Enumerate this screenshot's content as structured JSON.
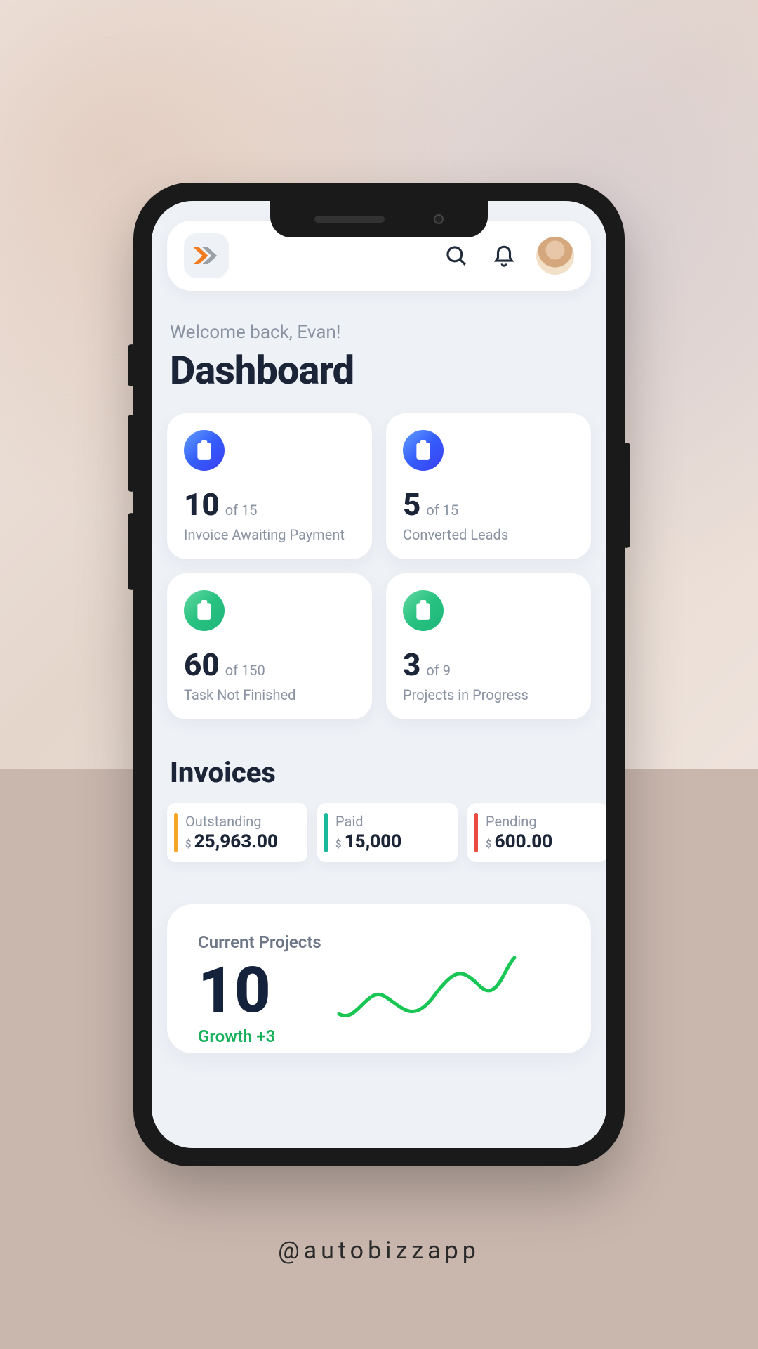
{
  "greeting": "Welcome back, Evan!",
  "page_title": "Dashboard",
  "stats": [
    {
      "value": "10",
      "of": "of 15",
      "label": "Invoice Awaiting Payment",
      "color": "blue"
    },
    {
      "value": "5",
      "of": "of 15",
      "label": "Converted Leads",
      "color": "blue"
    },
    {
      "value": "60",
      "of": "of 150",
      "label": "Task Not Finished",
      "color": "green"
    },
    {
      "value": "3",
      "of": "of 9",
      "label": "Projects in Progress",
      "color": "green"
    }
  ],
  "invoices_heading": "Invoices",
  "invoices": [
    {
      "label": "Outstanding",
      "currency": "$",
      "amount": "25,963.00",
      "accent": "orange"
    },
    {
      "label": "Paid",
      "currency": "$",
      "amount": "15,000",
      "accent": "teal"
    },
    {
      "label": "Pending",
      "currency": "$",
      "amount": "600.00",
      "accent": "red"
    }
  ],
  "projects": {
    "title": "Current Projects",
    "value": "10",
    "growth": "Growth +3"
  },
  "footer_handle": "@autobizzapp",
  "icons": {
    "search": "search-icon",
    "bell": "bell-icon",
    "logo": "app-logo-icon",
    "clipboard": "clipboard-icon"
  }
}
